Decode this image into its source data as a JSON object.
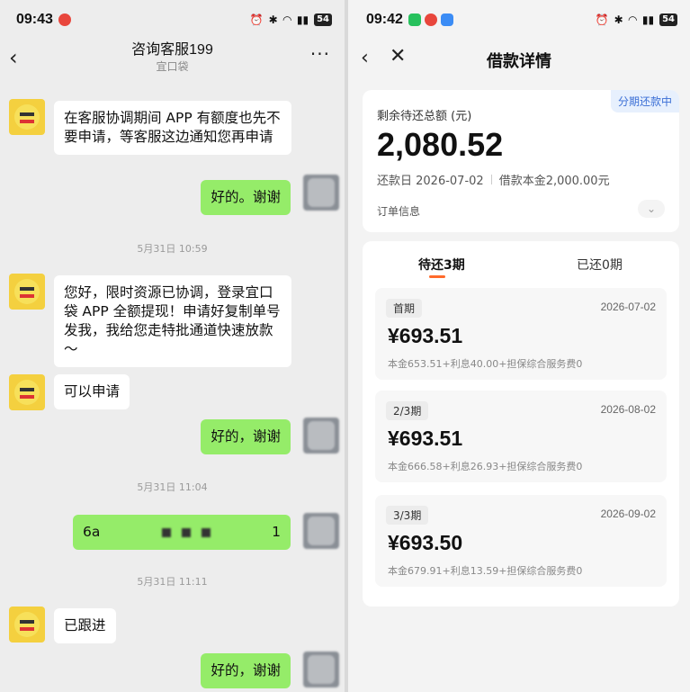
{
  "left": {
    "status": {
      "time": "09:43",
      "battery": "54"
    },
    "header": {
      "title": "咨询客服199",
      "subtitle": "宜口袋",
      "back": "‹",
      "more": "···"
    },
    "messages": [
      {
        "type": "in",
        "text": "在客服协调期间  APP 有额度也先不要申请，等客服这边通知您再申请"
      },
      {
        "type": "out",
        "text": "好的。谢谢"
      },
      {
        "type": "time",
        "text": "5月31日 10:59"
      },
      {
        "type": "in",
        "text": "您好，限时资源已协调，登录宜口袋 APP 全额提现！申请好复制单号发我，我给您走特批通道快速放款～"
      },
      {
        "type": "in",
        "text": "可以申请"
      },
      {
        "type": "out",
        "text": "好的，谢谢"
      },
      {
        "type": "time",
        "text": "5月31日 11:04"
      },
      {
        "type": "out_blur",
        "text_start": "6a",
        "text_end": "1"
      },
      {
        "type": "time",
        "text": "5月31日 11:11"
      },
      {
        "type": "in",
        "text": "已跟进"
      },
      {
        "type": "out",
        "text": "好的，谢谢"
      }
    ]
  },
  "right": {
    "status": {
      "time": "09:42",
      "battery": "54"
    },
    "nav": {
      "title": "借款详情",
      "back": "‹",
      "close": "✕"
    },
    "summary": {
      "tag": "分期还款中",
      "label": "剩余待还总额 (元)",
      "amount": "2,080.52",
      "due": "还款日 2026-07-02",
      "principal": "借款本金2,000.00元",
      "order": "订单信息",
      "chevron": "⌄"
    },
    "tabs": {
      "pending": "待还3期",
      "paid": "已还0期"
    },
    "periods": [
      {
        "name": "首期",
        "date": "2026-07-02",
        "amount": "¥693.51",
        "detail": "本金653.51+利息40.00+担保综合服务费0"
      },
      {
        "name": "2/3期",
        "date": "2026-08-02",
        "amount": "¥693.51",
        "detail": "本金666.58+利息26.93+担保综合服务费0"
      },
      {
        "name": "3/3期",
        "date": "2026-09-02",
        "amount": "¥693.50",
        "detail": "本金679.91+利息13.59+担保综合服务费0"
      }
    ]
  }
}
